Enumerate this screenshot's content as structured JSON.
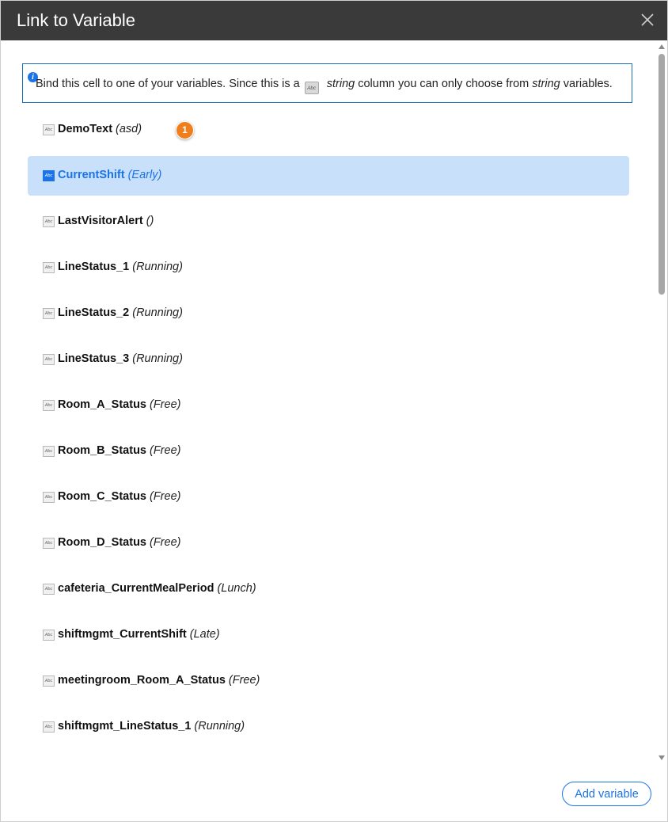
{
  "dialog": {
    "title": "Link to Variable",
    "close_icon": "close-icon"
  },
  "info": {
    "icon": "info-icon",
    "text_before": "Bind this cell to one of your variables. Since this is a",
    "type_icon_label": "Abc",
    "type_word": "string",
    "text_middle": "column you can only choose from",
    "type_word_2": "string",
    "text_after": "variables."
  },
  "badge": {
    "number": "1"
  },
  "variables": [
    {
      "name": "DemoText",
      "value": "(asd)",
      "icon_label": "Abc",
      "selected": false
    },
    {
      "name": "CurrentShift",
      "value": "(Early)",
      "icon_label": "Abc",
      "selected": true
    },
    {
      "name": "LastVisitorAlert",
      "value": "()",
      "icon_label": "Abc",
      "selected": false
    },
    {
      "name": "LineStatus_1",
      "value": "(Running)",
      "icon_label": "Abc",
      "selected": false
    },
    {
      "name": "LineStatus_2",
      "value": "(Running)",
      "icon_label": "Abc",
      "selected": false
    },
    {
      "name": "LineStatus_3",
      "value": "(Running)",
      "icon_label": "Abc",
      "selected": false
    },
    {
      "name": "Room_A_Status",
      "value": "(Free)",
      "icon_label": "Abc",
      "selected": false
    },
    {
      "name": "Room_B_Status",
      "value": "(Free)",
      "icon_label": "Abc",
      "selected": false
    },
    {
      "name": "Room_C_Status",
      "value": "(Free)",
      "icon_label": "Abc",
      "selected": false
    },
    {
      "name": "Room_D_Status",
      "value": "(Free)",
      "icon_label": "Abc",
      "selected": false
    },
    {
      "name": "cafeteria_CurrentMealPeriod",
      "value": "(Lunch)",
      "icon_label": "Abc",
      "selected": false
    },
    {
      "name": "shiftmgmt_CurrentShift",
      "value": "(Late)",
      "icon_label": "Abc",
      "selected": false
    },
    {
      "name": "meetingroom_Room_A_Status",
      "value": "(Free)",
      "icon_label": "Abc",
      "selected": false
    },
    {
      "name": "shiftmgmt_LineStatus_1",
      "value": "(Running)",
      "icon_label": "Abc",
      "selected": false
    }
  ],
  "footer": {
    "add_label": "Add variable"
  },
  "colors": {
    "titlebar": "#3a3a3a",
    "accent": "#1a73e8",
    "selected_bg": "#c9e0fb",
    "badge": "#f07e1a"
  }
}
